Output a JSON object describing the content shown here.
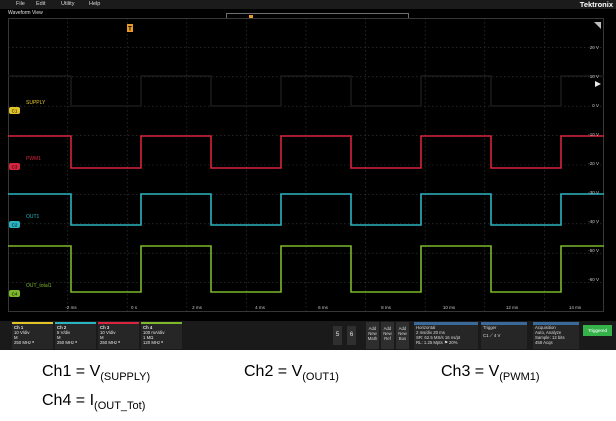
{
  "menu": {
    "items": [
      "File",
      "Edit",
      "Utility",
      "Help"
    ],
    "brand": "Tektronix"
  },
  "view_title": "Waveform View",
  "trigger_marker": "T",
  "waveforms": [
    {
      "label": "SUPPLY",
      "channel": "C1",
      "color": "#e3c428"
    },
    {
      "label": "PWM1",
      "channel": "C3",
      "color": "#d8243c"
    },
    {
      "label": "OUT1",
      "channel": "C2",
      "color": "#2ab4c0"
    },
    {
      "label": "OUT_total1",
      "channel": "C4",
      "color": "#7cb82a"
    }
  ],
  "right_axis": [
    "20 V",
    "10 V",
    "0 V",
    "-10 V",
    "-20 V",
    "-30 V",
    "-40 V",
    "-50 V",
    "-60 V"
  ],
  "time_axis": [
    "-2 ms",
    "0 s",
    "2 ms",
    "4 ms",
    "6 ms",
    "8 ms",
    "10 ms",
    "12 ms",
    "14 ms"
  ],
  "channels": [
    {
      "name": "Ch 1",
      "color": "#e3c428",
      "scale": "10 V/div",
      "coupling": "M",
      "bw": "250 MHz ᴮ"
    },
    {
      "name": "Ch 2",
      "color": "#2ab4c0",
      "scale": "5 V/div",
      "coupling": "M",
      "bw": "250 MHz ᴮ"
    },
    {
      "name": "Ch 3",
      "color": "#d8243c",
      "scale": "10 V/div",
      "coupling": "M",
      "bw": "250 MHz ᴮ"
    },
    {
      "name": "Ch 4",
      "color": "#7cb82a",
      "scale": "100 mA/div",
      "coupling": "1 MΩ",
      "bw": "120 MHz ᴮ"
    }
  ],
  "num_buttons": [
    "5",
    "6"
  ],
  "add_buttons": [
    [
      "Add",
      "New",
      "Math"
    ],
    [
      "Add",
      "New",
      "Ref"
    ],
    [
      "Add",
      "New",
      "Bus"
    ]
  ],
  "horizontal": {
    "title": "Horizontal",
    "lines": [
      "2 ms/div      20 ms",
      "SR: 62.5 MS/s   16 ns/pt",
      "RL: 1.25 Mpts   ⚑ 20%"
    ]
  },
  "trigger": {
    "title": "Trigger",
    "lines": [
      "C1  ⟋  4 V"
    ]
  },
  "acquisition": {
    "title": "Acquisition",
    "lines": [
      "Auto,   Analyze",
      "Sample: 12 bits",
      "458 Acqs"
    ]
  },
  "status": "Triggered",
  "caption": {
    "ch1_prefix": "Ch1 = V",
    "ch1_sub": "(SUPPLY)",
    "ch2_prefix": "Ch2 = V",
    "ch2_sub": "(OUT1)",
    "ch3_prefix": "Ch3 = V",
    "ch3_sub": "(PWM1)",
    "ch4_prefix": "Ch4 = I",
    "ch4_sub": "(OUT_Tot)"
  },
  "colors": {
    "ch1": "#e3c428",
    "ch2": "#2ab4c0",
    "ch3": "#d8243c",
    "ch4": "#7cb82a",
    "trace_black": "#1a1a1a",
    "triggered": "#35b24a",
    "marker": "#e89a2a"
  }
}
